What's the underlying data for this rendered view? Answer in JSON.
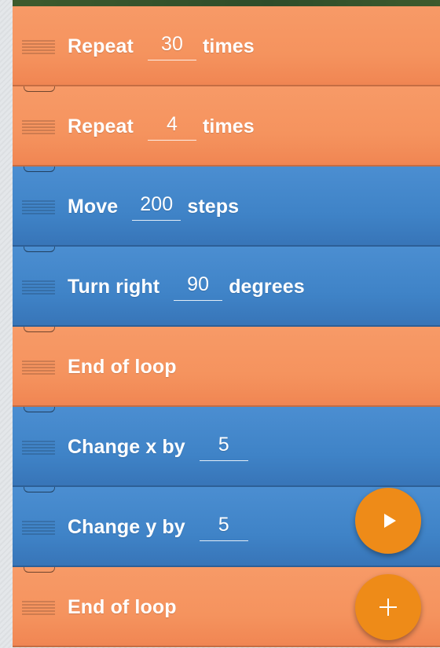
{
  "blocks": [
    {
      "type": "orange",
      "label": "Repeat",
      "value": "30",
      "suffix": "times"
    },
    {
      "type": "orange",
      "label": "Repeat",
      "value": "4",
      "suffix": "times"
    },
    {
      "type": "blue",
      "label": "Move",
      "value": "200",
      "suffix": "steps"
    },
    {
      "type": "blue",
      "label": "Turn right",
      "value": "90",
      "suffix": "degrees"
    },
    {
      "type": "orange",
      "label": "End of loop",
      "value": null,
      "suffix": null
    },
    {
      "type": "blue",
      "label": "Change x by",
      "value": "5",
      "suffix": null
    },
    {
      "type": "blue",
      "label": "Change y by",
      "value": "5",
      "suffix": null
    },
    {
      "type": "orange",
      "label": "End of loop",
      "value": null,
      "suffix": null
    }
  ],
  "colors": {
    "orange": "#f5935e",
    "blue": "#3f83c7",
    "fab": "#ee8b18"
  },
  "fabs": {
    "run_icon": "play-icon",
    "add_icon": "plus-icon"
  }
}
